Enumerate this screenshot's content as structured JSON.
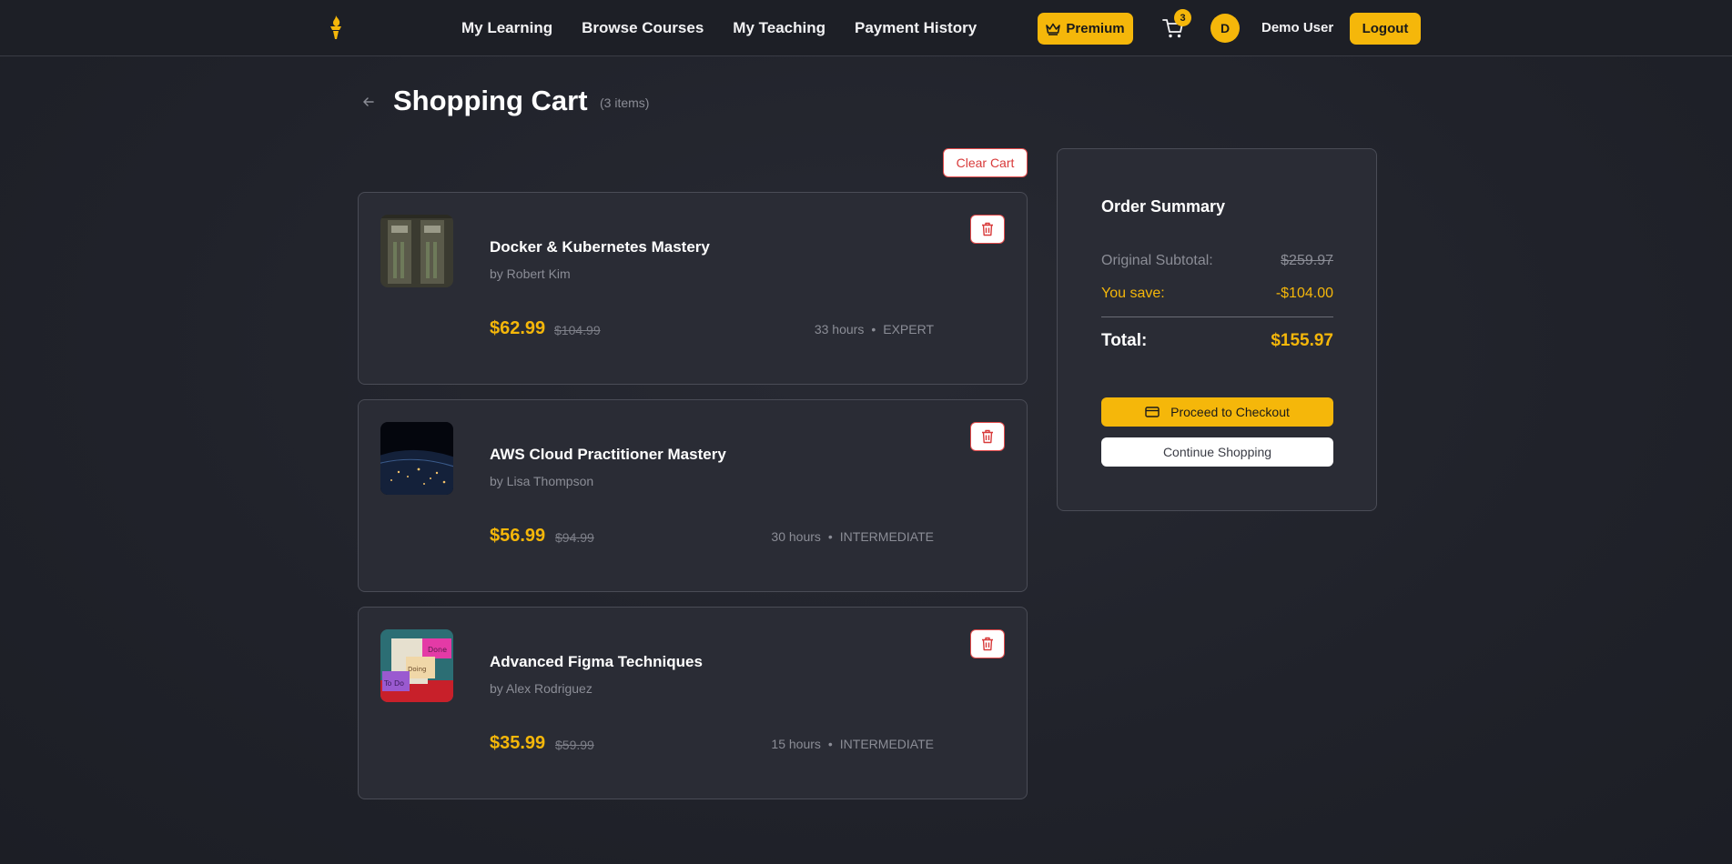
{
  "navbar": {
    "links": [
      "My Learning",
      "Browse Courses",
      "My Teaching",
      "Payment History"
    ],
    "premium_label": "Premium",
    "cart_count": "3",
    "avatar_initial": "D",
    "username": "Demo User",
    "logout_label": "Logout"
  },
  "page": {
    "title": "Shopping Cart",
    "item_count": "(3 items)",
    "clear_cart_label": "Clear Cart"
  },
  "cart_items": [
    {
      "title": "Docker & Kubernetes Mastery",
      "instructor": "by Robert Kim",
      "price": "$62.99",
      "original_price": "$104.99",
      "duration": "33 hours",
      "level": "EXPERT"
    },
    {
      "title": "AWS Cloud Practitioner Mastery",
      "instructor": "by Lisa Thompson",
      "price": "$56.99",
      "original_price": "$94.99",
      "duration": "30 hours",
      "level": "INTERMEDIATE"
    },
    {
      "title": "Advanced Figma Techniques",
      "instructor": "by Alex Rodriguez",
      "price": "$35.99",
      "original_price": "$59.99",
      "duration": "15 hours",
      "level": "INTERMEDIATE"
    }
  ],
  "summary": {
    "title": "Order Summary",
    "subtotal_label": "Original Subtotal:",
    "subtotal_value": "$259.97",
    "save_label": "You save:",
    "save_value": "-$104.00",
    "total_label": "Total:",
    "total_value": "$155.97",
    "checkout_label": "Proceed to Checkout",
    "continue_label": "Continue Shopping"
  },
  "colors": {
    "accent": "#f5b70a",
    "danger": "#e24a4a",
    "background": "#22242b",
    "card": "#2a2c35"
  },
  "icons": {
    "logo": "torch-logo-icon",
    "premium": "crown-icon",
    "cart": "shopping-cart-icon",
    "back": "arrow-left-icon",
    "delete": "trash-icon",
    "checkout": "credit-card-icon"
  }
}
